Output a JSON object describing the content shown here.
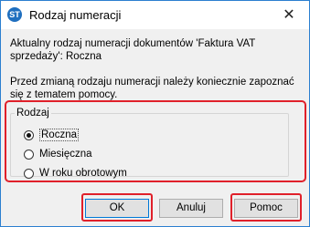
{
  "window": {
    "title": "Rodzaj numeracji",
    "icon": "app-logo-icon",
    "icon_text": "ST",
    "close_glyph": "✕"
  },
  "content": {
    "current_numbering_text": "Aktualny rodzaj numeracji dokumentów 'Faktura VAT sprzedaży': Roczna",
    "warning_text": "Przed zmianą rodzaju numeracji należy koniecznie zapoznać się z tematem pomocy."
  },
  "group": {
    "label": "Rodzaj",
    "options": [
      {
        "label": "Roczna",
        "selected": true
      },
      {
        "label": "Miesięczna",
        "selected": false
      },
      {
        "label": "W roku obrotowym",
        "selected": false
      }
    ]
  },
  "buttons": {
    "ok": "OK",
    "cancel": "Anuluj",
    "help": "Pomoc"
  },
  "colors": {
    "highlight": "#e0202a",
    "accent": "#0078d7",
    "dialog_bg": "#f0f0f0"
  }
}
